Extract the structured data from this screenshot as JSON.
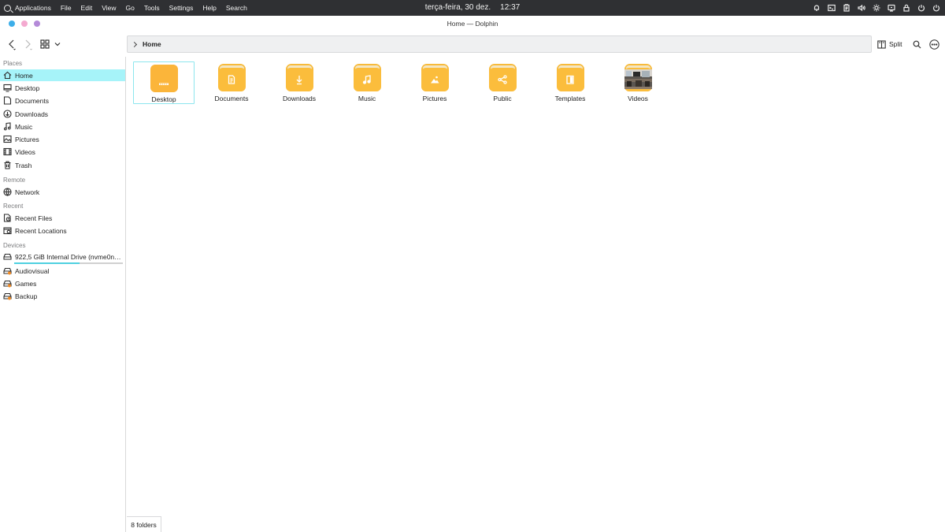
{
  "topbar": {
    "menu": [
      "Applications",
      "File",
      "Edit",
      "View",
      "Go",
      "Tools",
      "Settings",
      "Help",
      "Search"
    ],
    "date": "terça-feira, 30 dez.",
    "time": "12:37",
    "tray_icons": [
      "bell-icon",
      "terminal-icon",
      "clipboard-icon",
      "volume-icon",
      "brightness-icon",
      "kdeconnect-icon",
      "lock-icon",
      "power-icon",
      "power-off-icon"
    ]
  },
  "window": {
    "title": "Home — Dolphin",
    "dot_colors": [
      "#3daee9",
      "#f4a9d0",
      "#b48ad8"
    ]
  },
  "toolbar": {
    "breadcrumb": "Home",
    "split_label": "Split"
  },
  "sidebar": {
    "places_title": "Places",
    "places": [
      {
        "label": "Home",
        "icon": "home-icon",
        "active": true
      },
      {
        "label": "Desktop",
        "icon": "desktop-icon"
      },
      {
        "label": "Documents",
        "icon": "document-icon"
      },
      {
        "label": "Downloads",
        "icon": "download-icon"
      },
      {
        "label": "Music",
        "icon": "music-icon"
      },
      {
        "label": "Pictures",
        "icon": "picture-icon"
      },
      {
        "label": "Videos",
        "icon": "video-icon"
      },
      {
        "label": "Trash",
        "icon": "trash-icon"
      }
    ],
    "remote_title": "Remote",
    "remote": [
      {
        "label": "Network",
        "icon": "network-icon"
      }
    ],
    "recent_title": "Recent",
    "recent": [
      {
        "label": "Recent Files",
        "icon": "recent-files-icon"
      },
      {
        "label": "Recent Locations",
        "icon": "recent-locations-icon"
      }
    ],
    "devices_title": "Devices",
    "devices": [
      {
        "label": "922,5 GiB Internal Drive (nvme0n…",
        "icon": "drive-icon",
        "usage_fraction": 0.6
      },
      {
        "label": "Audiovisual",
        "icon": "external-drive-icon"
      },
      {
        "label": "Games",
        "icon": "external-drive-icon"
      },
      {
        "label": "Backup",
        "icon": "external-drive-icon"
      }
    ]
  },
  "files": [
    {
      "name": "Desktop",
      "emblem": "desktop-emblem-icon"
    },
    {
      "name": "Documents",
      "emblem": "document-emblem-icon"
    },
    {
      "name": "Downloads",
      "emblem": "download-emblem-icon"
    },
    {
      "name": "Music",
      "emblem": "music-emblem-icon"
    },
    {
      "name": "Pictures",
      "emblem": "picture-emblem-icon"
    },
    {
      "name": "Public",
      "emblem": "share-emblem-icon"
    },
    {
      "name": "Templates",
      "emblem": "template-emblem-icon"
    },
    {
      "name": "Videos",
      "emblem": "video-thumbnail-icon"
    }
  ],
  "statusbar": {
    "text": "8 folders"
  }
}
